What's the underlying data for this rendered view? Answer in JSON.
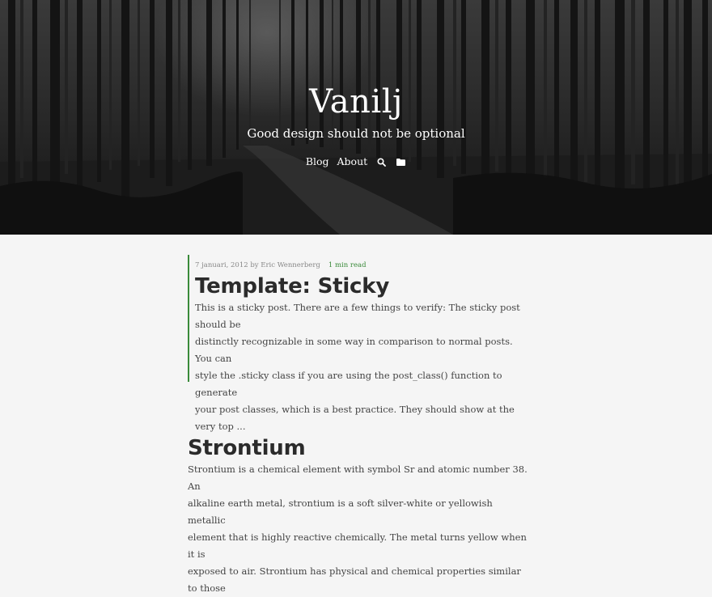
{
  "site": {
    "title": "Vanilj",
    "tagline": "Good design should not be optional"
  },
  "nav": {
    "items": [
      {
        "label": "Blog"
      },
      {
        "label": "About"
      }
    ],
    "icons": [
      "search-icon",
      "folder-icon"
    ]
  },
  "posts": [
    {
      "meta_date_author": "7 januari, 2012 by Eric Wennerberg",
      "read_time": "1 min read",
      "title": "Template: Sticky",
      "excerpt_lines": [
        "This is a sticky post. There are a few things to verify: The sticky post should be",
        "distinctly recognizable in some way in comparison to normal posts. You can",
        "style the .sticky class if you are using the post_class() function to generate",
        "your post classes, which is a best practice. They should show at the very top ..."
      ]
    },
    {
      "title": "Strontium",
      "excerpt_lines": [
        "Strontium is a chemical element with symbol Sr and atomic number 38. An",
        "alkaline earth metal, strontium is a soft silver-white or yellowish metallic",
        "element that is highly reactive chemically. The metal turns yellow when it is",
        "exposed to air. Strontium has physical and chemical properties similar to those"
      ]
    }
  ],
  "colors": {
    "accent": "#3a8a3a",
    "background": "#f5f5f5",
    "title_text": "#2b2b2b"
  }
}
